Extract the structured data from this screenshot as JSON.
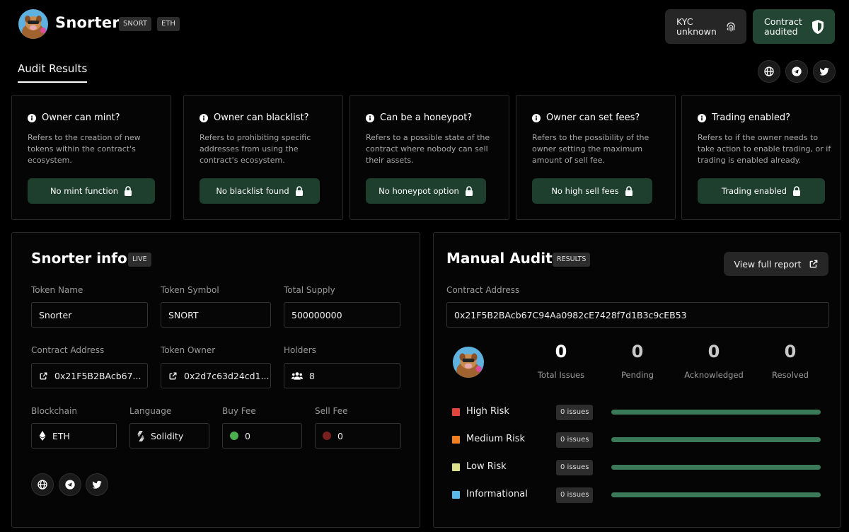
{
  "header": {
    "title": "Snorter",
    "tags": [
      "SNORT",
      "ETH"
    ],
    "kyc_label": "KYC\nunknown",
    "audit_label": "Contract\naudited"
  },
  "tabs": {
    "audit_results": "Audit Results"
  },
  "checks": [
    {
      "question": "Owner can mint?",
      "desc": "Refers to the creation of new tokens within the contract's ecosystem.",
      "result": "No mint function"
    },
    {
      "question": "Owner can blacklist?",
      "desc": "Refers to prohibiting specific addresses from using the contract's ecosystem.",
      "result": "No blacklist found"
    },
    {
      "question": "Can be a honeypot?",
      "desc": "Refers to a possible state of the contract where nobody can sell their assets.",
      "result": "No honeypot option"
    },
    {
      "question": "Owner can set fees?",
      "desc": "Refers to the possibility of the owner setting the maximum amount of sell fee.",
      "result": "No high sell fees"
    },
    {
      "question": "Trading enabled?",
      "desc": "Refers to if the owner needs to take action to enable trading, or if trading is enabled already.",
      "result": "Trading enabled"
    }
  ],
  "info": {
    "title": "Snorter info",
    "badge": "LIVE",
    "token_name_label": "Token Name",
    "token_name": "Snorter",
    "token_symbol_label": "Token Symbol",
    "token_symbol": "SNORT",
    "total_supply_label": "Total Supply",
    "total_supply": "500000000",
    "contract_address_label": "Contract Address",
    "contract_address": "0x21F5B2BAcb67...",
    "token_owner_label": "Token Owner",
    "token_owner": "0x2d7c63d24cd1...",
    "holders_label": "Holders",
    "holders": "8",
    "blockchain_label": "Blockchain",
    "blockchain": "ETH",
    "language_label": "Language",
    "language": "Solidity",
    "buy_fee_label": "Buy Fee",
    "buy_fee": "0",
    "sell_fee_label": "Sell Fee",
    "sell_fee": "0",
    "buy_fee_color": "#4caf50",
    "sell_fee_color": "#7a1f1f"
  },
  "audit": {
    "title": "Manual Audit",
    "badge": "RESULTS",
    "view_report": "View full report",
    "contract_address_label": "Contract Address",
    "contract_address": "0x21F5B2BAcb67C94Aa0982cE7428f7d1B3c9cEB53",
    "stats": [
      {
        "value": "0",
        "label": "Total Issues"
      },
      {
        "value": "0",
        "label": "Pending"
      },
      {
        "value": "0",
        "label": "Acknowledged"
      },
      {
        "value": "0",
        "label": "Resolved"
      }
    ],
    "risks": [
      {
        "label": "High Risk",
        "issues": "0 issues",
        "color": "#e0463c"
      },
      {
        "label": "Medium Risk",
        "issues": "0 issues",
        "color": "#f07f22"
      },
      {
        "label": "Low Risk",
        "issues": "0 issues",
        "color": "#dbe28a"
      },
      {
        "label": "Informational",
        "issues": "0 issues",
        "color": "#5ab8e8"
      }
    ]
  },
  "colors": {
    "accent_green": "#234634",
    "bar_green": "#3b7a58"
  },
  "icons": [
    "fingerprint-icon",
    "shield-icon",
    "globe-icon",
    "telegram-icon",
    "twitter-icon",
    "info-icon",
    "lock-icon",
    "external-link-icon",
    "users-icon",
    "ethereum-icon",
    "solidity-icon"
  ]
}
